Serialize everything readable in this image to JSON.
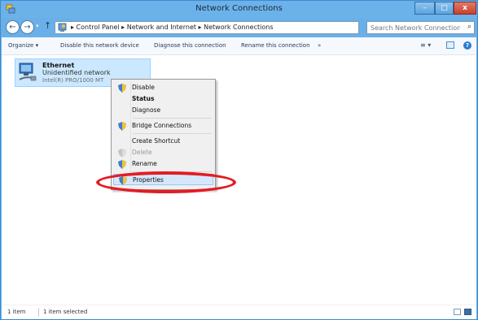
{
  "window": {
    "title": "Network Connections",
    "minimize_label": "–",
    "maximize_label": "□",
    "close_label": "x"
  },
  "navigation": {
    "back_label": "←",
    "forward_label": "→",
    "recent_label": "▾",
    "up_label": "↑",
    "breadcrumb": "▸  Control Panel  ▸  Network and Internet  ▸  Network Connections",
    "address_dropdown": "∨",
    "refresh_label": "⟳",
    "search_placeholder": "Search Network Connections",
    "search_icon_glyph": "⌕"
  },
  "commandbar": {
    "organize": "Organize ▾",
    "disable": "Disable this network device",
    "diagnose": "Diagnose this connection",
    "rename": "Rename this connection",
    "more": "»",
    "view_label": "≡ ▾",
    "help_label": "?"
  },
  "connection": {
    "name": "Ethernet",
    "status": "Unidentified network",
    "adapter": "Intel(R) PRO/1000 MT"
  },
  "context_menu": {
    "items": [
      {
        "label": "Disable",
        "icon": "shield-icon"
      },
      {
        "label": "Status"
      },
      {
        "label": "Diagnose"
      },
      {
        "label": "Bridge Connections",
        "icon": "shield-icon"
      },
      {
        "label": "Create Shortcut"
      },
      {
        "label": "Delete",
        "icon": "shield-icon",
        "disabled": true
      },
      {
        "label": "Rename",
        "icon": "shield-icon"
      },
      {
        "label": "Properties",
        "icon": "shield-icon",
        "highlighted": true
      }
    ]
  },
  "statusbar": {
    "item_count": "1 item",
    "selected": "1 item selected"
  },
  "colors": {
    "titlebar": "#6cb2ea",
    "selection": "#cce8ff",
    "annotation": "#e31c23"
  }
}
